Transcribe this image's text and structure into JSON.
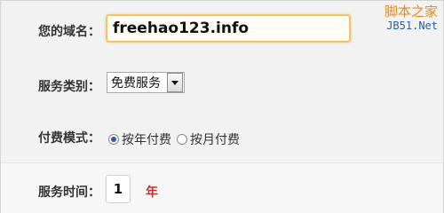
{
  "form": {
    "domain_label": "您的域名：",
    "domain_value": "freehao123.info",
    "type_label": "服务类别：",
    "type_selected": "免费服务",
    "pay_label": "付费模式：",
    "pay_options": [
      {
        "label": "按年付费",
        "checked": true
      },
      {
        "label": "按月付费",
        "checked": false
      }
    ],
    "time_label": "服务时间：",
    "time_value": "1",
    "time_unit": "年"
  },
  "watermark": {
    "line1": "脚本之家",
    "line2": "JB51.Net"
  }
}
